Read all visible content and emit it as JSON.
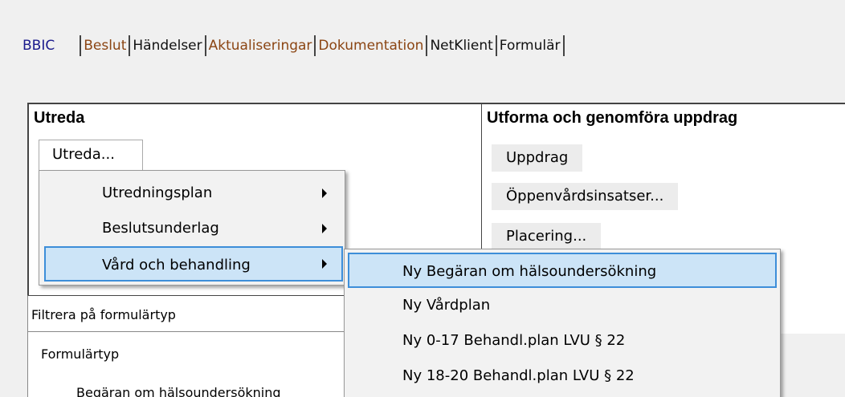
{
  "tabs": [
    {
      "label": "BBIC",
      "color": "#1a1a8c"
    },
    {
      "label": "Beslut",
      "color": "#8b4513"
    },
    {
      "label": "Händelser",
      "color": "#111111"
    },
    {
      "label": "Aktualiseringar",
      "color": "#8b4513"
    },
    {
      "label": "Dokumentation",
      "color": "#8b4513"
    },
    {
      "label": "NetKlient",
      "color": "#111111"
    },
    {
      "label": "Formulär",
      "color": "#111111"
    }
  ],
  "left_panel": {
    "title": "Utreda",
    "button_label": "Utreda..."
  },
  "right_panel": {
    "title": "Utforma och genomföra uppdrag",
    "buttons": [
      "Uppdrag",
      "Öppenvårdsinsatser...",
      "Placering..."
    ]
  },
  "context_menu": {
    "items": [
      {
        "label": "Utredningsplan",
        "arrow": "right-arrow-icon"
      },
      {
        "label": "Beslutsunderlag",
        "arrow": "right-arrow-icon"
      },
      {
        "label": "Vård och behandling",
        "arrow": "right-arrow-icon"
      }
    ]
  },
  "submenu": {
    "items": [
      "Ny Begäran om hälsoundersökning",
      "Ny Vårdplan",
      "Ny 0-17 Behandl.plan LVU § 22",
      "Ny 18-20 Behandl.plan LVU § 22"
    ]
  },
  "filter": {
    "label": "Filtrera på formulärtyp",
    "column_header": "Formulärtyp",
    "first_row": "Begäran om hälsoundersökning"
  },
  "colors": {
    "highlight_fill": "#cce4f7",
    "highlight_border": "#3d8ed9"
  }
}
